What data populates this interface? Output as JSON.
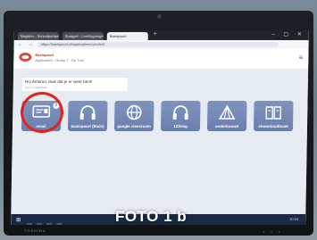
{
  "browser": {
    "tabs": [
      {
        "label": "Magister - Schoolportaal",
        "active": false
      },
      {
        "label": "Snappet - Leerlingomgeving",
        "active": false
      },
      {
        "label": "Basispoort",
        "active": true
      }
    ],
    "address": "https://basispoort.nl/applicaties/overzicht"
  },
  "app": {
    "title": "Basispoort",
    "subtitle": "Applicaties - Groep 7 - De Tuin"
  },
  "greeting": {
    "text": "Hoi Amaron, leuk dat je er weer bent!",
    "small": "Kies een applicatie"
  },
  "tiles": [
    {
      "label": "email",
      "icon": "mail-icon",
      "badge": "2"
    },
    {
      "label": "basispoort (thuis)",
      "icon": "headphones-icon",
      "badge": ""
    },
    {
      "label": "google classroom",
      "icon": "globe-icon",
      "badge": ""
    },
    {
      "label": "123ring",
      "icon": "headphones-icon",
      "badge": ""
    },
    {
      "label": "onderbouwd",
      "icon": "tent-icon",
      "badge": ""
    },
    {
      "label": "showcloudbook",
      "icon": "book-icon",
      "badge": ""
    }
  ],
  "taskbar": {
    "clock": "10:24"
  },
  "laptop": {
    "brand": "TOSHIBA"
  },
  "caption": "FOTO 1 b",
  "colors": {
    "tile": "#6a7fae",
    "highlight_circle": "#e2231a"
  }
}
